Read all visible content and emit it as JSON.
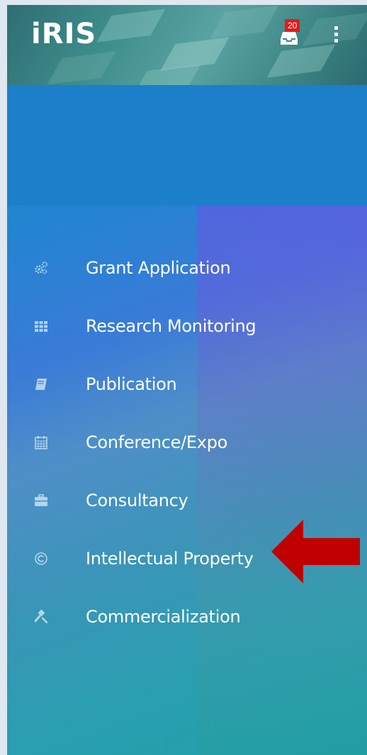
{
  "header": {
    "logo": "iRIS",
    "notification_count": "20",
    "accent_color": "#e31b1b"
  },
  "menu": {
    "items": [
      {
        "label": "Grant Application",
        "icon": "cogs-icon"
      },
      {
        "label": "Research Monitoring",
        "icon": "grid-icon"
      },
      {
        "label": "Publication",
        "icon": "book-icon"
      },
      {
        "label": "Conference/Expo",
        "icon": "calendar-icon"
      },
      {
        "label": "Consultancy",
        "icon": "briefcase-icon"
      },
      {
        "label": "Intellectual Property",
        "icon": "copyright-icon"
      },
      {
        "label": "Commercialization",
        "icon": "gavel-icon"
      }
    ]
  },
  "annotation": {
    "arrow_color": "#c00000"
  }
}
